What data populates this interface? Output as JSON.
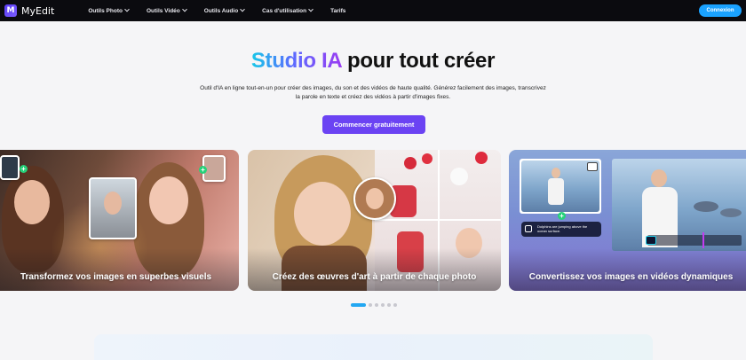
{
  "nav": {
    "logo_letter": "M",
    "logo_text": "MyEdit",
    "menu": [
      {
        "label": "Outils Photo",
        "has_chevron": true
      },
      {
        "label": "Outils Vidéo",
        "has_chevron": true
      },
      {
        "label": "Outils Audio",
        "has_chevron": true
      },
      {
        "label": "Cas d'utilisation",
        "has_chevron": true
      },
      {
        "label": "Tarifs",
        "has_chevron": false
      }
    ],
    "login_label": "Connexion"
  },
  "hero": {
    "title_gradient": "Studio IA",
    "title_rest": "pour tout créer",
    "subtitle": "Outil d'IA en ligne tout-en-un pour créer des images, du son et des vidéos de haute qualité. Générez facilement des images, transcrivez la parole en texte et créez des vidéos à partir d'images fixes.",
    "cta_label": "Commencer gratuitement"
  },
  "cards": [
    {
      "label": "Transformez vos images en superbes visuels"
    },
    {
      "label": "Créez des œuvres d'art à partir de chaque photo"
    },
    {
      "label": "Convertissez vos images en vidéos dynamiques",
      "prompt_text": "Dolphins are jumping above the ocean surface."
    }
  ],
  "carousel": {
    "dot_count": 6,
    "active_index": 0
  },
  "colors": {
    "nav_bg": "#0b0b0f",
    "login_button": "#1aa2ff",
    "cta_button": "#6b43f3",
    "active_dot": "#22a7f2"
  }
}
